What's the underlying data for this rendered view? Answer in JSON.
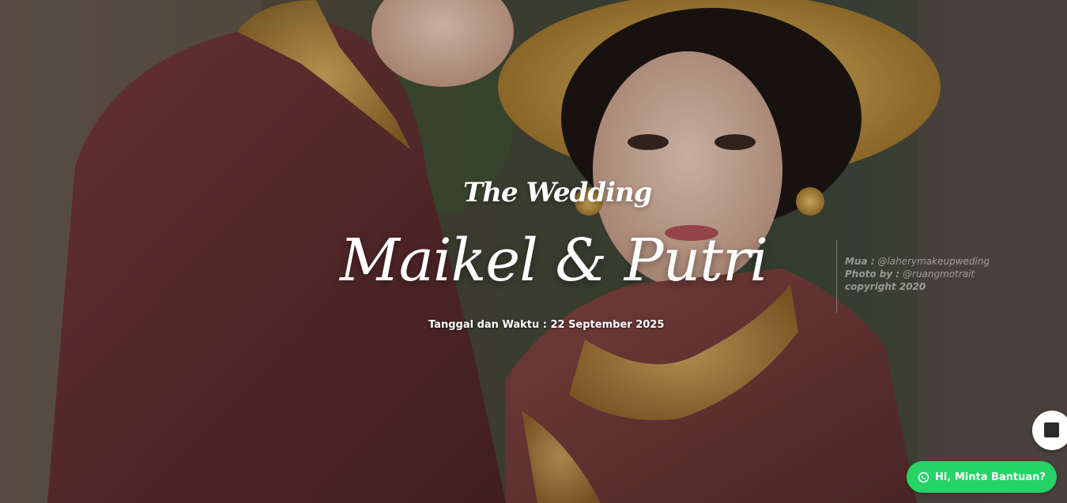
{
  "hero": {
    "subtitle": "The Wedding",
    "couple_names": "Maikel & Putri",
    "date_line": "Tanggal dan Waktu : 22 September 2025"
  },
  "photo_credits": {
    "mua_label": "Mua :",
    "mua_value": "@laherymakeupweding",
    "photo_label": "Photo by :",
    "photo_value": "@ruangmotrait",
    "copyright": "copyright 2020"
  },
  "music_toggle": {
    "icon": "stop-icon"
  },
  "help_button": {
    "label": "Hi, Minta Bantuan?",
    "icon": "whatsapp-icon",
    "color": "#25d366"
  },
  "colors": {
    "accent_green": "#25d366",
    "text": "#ffffff"
  }
}
